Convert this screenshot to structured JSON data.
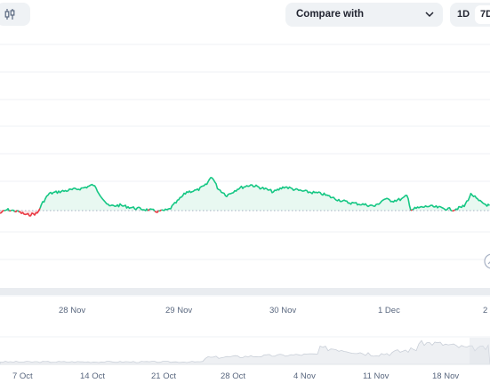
{
  "toolbar": {
    "chart_type_icon": "candlestick-icon",
    "compare_label": "Compare with",
    "compare_icon": "chevron-down-icon",
    "ranges": [
      "1D",
      "7D"
    ],
    "active_range": "7D"
  },
  "chart_data": {
    "type": "area",
    "x_tick_labels": [
      "28 Nov",
      "29 Nov",
      "30 Nov",
      "1 Dec",
      "2"
    ],
    "baseline_style": "dotted",
    "colors": {
      "above": "#16c784",
      "below": "#ea3943",
      "fill_above": "#e8f8f1"
    }
  },
  "navigator": {
    "tick_labels": [
      "7 Oct",
      "14 Oct",
      "21 Oct",
      "28 Oct",
      "4 Nov",
      "11 Nov",
      "18 Nov"
    ]
  },
  "overlay_icon": "zoom-reset-icon"
}
